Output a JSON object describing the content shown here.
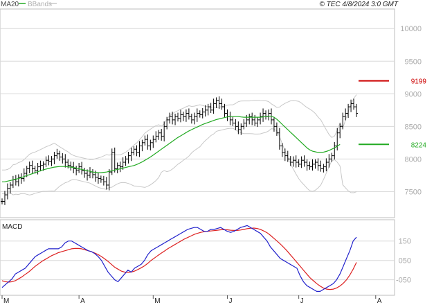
{
  "header": {
    "ma_label": "MA20",
    "bb_label": "BBands",
    "copyright": "© TEC 4/8/2024 3:0 GMT"
  },
  "macd_panel": {
    "title": "MACD"
  },
  "colors": {
    "ma": "#22aa22",
    "bbands": "#c8c8c8",
    "resistance": "#cc0000",
    "support": "#22aa22",
    "macd": "#2222cc",
    "signal": "#dd2222",
    "candle": "#000000",
    "grid": "#d8d8d8"
  },
  "chart_data": [
    {
      "type": "line",
      "name": "price",
      "y_ticks": [
        10000,
        9500,
        9000,
        8500,
        8000,
        7500
      ],
      "y_tick_labels": [
        "10000",
        "9500",
        "9000",
        "8500",
        "8000",
        "7500"
      ],
      "ylim": [
        7100,
        10300
      ],
      "x_labels": [
        "M",
        "A",
        "M",
        "J",
        "J",
        "A"
      ],
      "x_label_index": [
        0,
        28,
        55,
        82,
        108,
        136
      ],
      "levels": [
        {
          "name": "resistance",
          "value": 9199,
          "label": "9199"
        },
        {
          "name": "support",
          "value": 8224,
          "label": "8224"
        }
      ],
      "closes": [
        7350,
        7450,
        7550,
        7600,
        7680,
        7650,
        7720,
        7700,
        7780,
        7850,
        7900,
        7850,
        7820,
        7880,
        7900,
        7920,
        7980,
        7960,
        8000,
        8050,
        8080,
        8030,
        8000,
        7950,
        7900,
        7880,
        7850,
        7830,
        7880,
        7820,
        7780,
        7750,
        7800,
        7760,
        7720,
        7700,
        7680,
        7650,
        7600,
        7800,
        8100,
        7850,
        7900,
        7880,
        7950,
        8000,
        8050,
        8100,
        8150,
        8100,
        8200,
        8250,
        8300,
        8200,
        8250,
        8300,
        8350,
        8400,
        8350,
        8500,
        8600,
        8650,
        8600,
        8650,
        8620,
        8680,
        8650,
        8700,
        8650,
        8600,
        8650,
        8700,
        8680,
        8720,
        8750,
        8800,
        8750,
        8850,
        8900,
        8850,
        8800,
        8700,
        8650,
        8600,
        8550,
        8500,
        8450,
        8500,
        8550,
        8600,
        8650,
        8600,
        8550,
        8600,
        8650,
        8700,
        8650,
        8700,
        8600,
        8500,
        8400,
        8200,
        8100,
        8050,
        8000,
        7950,
        7980,
        7950,
        7920,
        7980,
        7950,
        7900,
        7880,
        7920,
        7950,
        7900,
        7850,
        7880,
        7950,
        8000,
        8050,
        8200,
        8400,
        8500,
        8650,
        8700,
        8800,
        8850,
        8800,
        8700
      ],
      "ma20": [
        7650,
        7650,
        7660,
        7670,
        7680,
        7690,
        7700,
        7715,
        7730,
        7745,
        7760,
        7775,
        7790,
        7805,
        7820,
        7835,
        7845,
        7855,
        7865,
        7875,
        7880,
        7885,
        7885,
        7885,
        7880,
        7875,
        7870,
        7860,
        7850,
        7840,
        7830,
        7820,
        7810,
        7800,
        7795,
        7790,
        7790,
        7795,
        7800,
        7810,
        7820,
        7830,
        7840,
        7850,
        7860,
        7870,
        7880,
        7890,
        7900,
        7915,
        7935,
        7955,
        7980,
        8005,
        8030,
        8060,
        8090,
        8120,
        8150,
        8180,
        8210,
        8240,
        8270,
        8300,
        8330,
        8355,
        8380,
        8405,
        8430,
        8450,
        8470,
        8490,
        8510,
        8530,
        8545,
        8560,
        8575,
        8590,
        8605,
        8615,
        8625,
        8635,
        8645,
        8650,
        8650,
        8650,
        8650,
        8645,
        8640,
        8640,
        8640,
        8640,
        8640,
        8640,
        8640,
        8645,
        8650,
        8655,
        8655,
        8640,
        8610,
        8570,
        8530,
        8490,
        8450,
        8410,
        8370,
        8330,
        8290,
        8250,
        8210,
        8170,
        8140,
        8120,
        8110,
        8100,
        8100,
        8105,
        8115,
        8130,
        8150,
        8170,
        8195,
        8224
      ]
    },
    {
      "type": "line",
      "name": "macd",
      "y_ticks": [
        150,
        50,
        -50
      ],
      "y_tick_labels": [
        "150",
        "050",
        "-050"
      ],
      "ylim": [
        -130,
        260
      ],
      "macd": [
        -90,
        -75,
        -60,
        -45,
        -20,
        -10,
        0,
        10,
        30,
        50,
        70,
        80,
        90,
        100,
        110,
        110,
        110,
        110,
        120,
        140,
        150,
        150,
        140,
        130,
        120,
        110,
        100,
        95,
        85,
        70,
        50,
        20,
        -10,
        -30,
        -50,
        -60,
        -40,
        -20,
        0,
        -10,
        10,
        20,
        30,
        50,
        80,
        100,
        110,
        120,
        130,
        140,
        150,
        160,
        170,
        180,
        190,
        200,
        210,
        215,
        220,
        220,
        210,
        200,
        200,
        210,
        210,
        215,
        220,
        210,
        200,
        195,
        200,
        210,
        220,
        225,
        230,
        220,
        210,
        200,
        190,
        170,
        150,
        120,
        100,
        80,
        60,
        50,
        40,
        30,
        20,
        10,
        -30,
        -60,
        -80,
        -90,
        -100,
        -110,
        -110,
        -100,
        -90,
        -80,
        -70,
        -50,
        -20,
        20,
        60,
        100,
        150,
        170
      ],
      "signal": [
        -55,
        -60,
        -62,
        -60,
        -55,
        -45,
        -35,
        -22,
        -10,
        5,
        20,
        32,
        45,
        55,
        65,
        75,
        82,
        90,
        95,
        100,
        105,
        110,
        112,
        112,
        110,
        105,
        100,
        95,
        88,
        80,
        70,
        58,
        45,
        30,
        15,
        5,
        -5,
        -10,
        -12,
        -10,
        -5,
        3,
        12,
        22,
        35,
        50,
        62,
        75,
        87,
        98,
        110,
        120,
        130,
        140,
        150,
        160,
        168,
        176,
        184,
        190,
        195,
        198,
        200,
        202,
        204,
        206,
        208,
        209,
        208,
        206,
        205,
        205,
        207,
        210,
        214,
        216,
        217,
        215,
        210,
        202,
        193,
        180,
        165,
        150,
        135,
        118,
        100,
        80,
        60,
        40,
        20,
        0,
        -20,
        -40,
        -55,
        -70,
        -82,
        -92,
        -98,
        -100,
        -98,
        -92,
        -82,
        -68,
        -50,
        -25,
        5,
        40
      ]
    }
  ]
}
